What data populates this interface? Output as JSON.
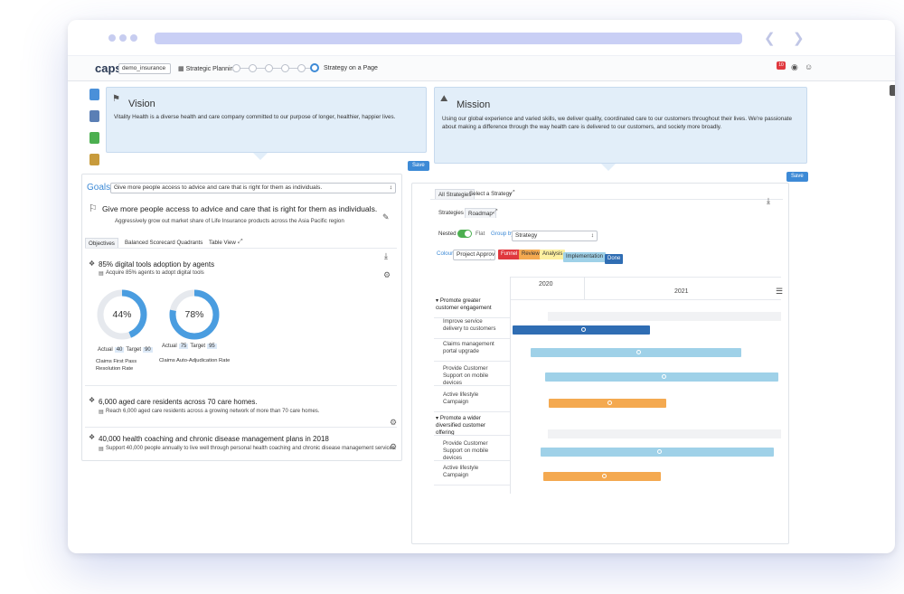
{
  "header": {
    "logo_main": "capsi",
    "logo_accent": "fi",
    "workspace": "demo_insurance",
    "nav_item": "Strategic Planning",
    "current_step": "Strategy on a Page",
    "notifications_count": "10"
  },
  "vision": {
    "title": "Vision",
    "text": "Vitality Health is a diverse health and care company committed to our purpose of longer, healthier, happier lives.",
    "save_label": "Save"
  },
  "mission": {
    "title": "Mission",
    "text": "Using our global experience and varied skills, we deliver quality, coordinated care to our customers throughout their lives. We're passionate about making a difference through the way health care is delivered to our customers, and society more broadly.",
    "save_label": "Save"
  },
  "goals": {
    "label": "Goals",
    "selected": "Give more people access to advice and care that is right for them as individuals.",
    "headline": "Give more people access to advice and care that is right for them as individuals.",
    "subtitle": "Aggressively grow out market share of Life Insurance products across the Asia Pacific region",
    "tabs": [
      "Objectives",
      "Balanced Scorecard Quadrants",
      "Table View"
    ],
    "objectives": [
      {
        "title": "85% digital tools adoption by agents",
        "subtitle": "Acquire 85% agents to adopt digital tools"
      },
      {
        "title": "6,000 aged care residents across 70 care homes.",
        "subtitle": "Reach 6,000 aged care residents across a growing network of more than 70 care homes."
      },
      {
        "title": "40,000 health coaching and chronic disease management plans in 2018",
        "subtitle": "Support 40,000 people annually to live well through personal health coaching and chronic disease management services."
      }
    ],
    "kpis": [
      {
        "pct_label": "44%",
        "pct": 44,
        "actual_label": "Actual",
        "actual": "40",
        "target_label": "Target",
        "target": "90",
        "name": "Claims First Pass Resolution Rate"
      },
      {
        "pct_label": "78%",
        "pct": 78,
        "actual_label": "Actual",
        "actual": "75",
        "target_label": "Target",
        "target": "95",
        "name": "Claims Auto-Adjudication Rate"
      }
    ]
  },
  "strategies": {
    "tabs": [
      "All Strategies",
      "Select a Strategy"
    ],
    "subtabs": [
      "Strategies",
      "Roadmap"
    ],
    "nested_label": "Nested",
    "flat_label": "Flat",
    "group_by_label": "Group by",
    "group_by_value": "Strategy",
    "colour_label": "Colour",
    "colour_value": "Project Approv",
    "stages": [
      {
        "label": "Funnel",
        "color": "#e0383e",
        "text": "#ffffff"
      },
      {
        "label": "Review",
        "color": "#f4a950",
        "text": "#333333"
      },
      {
        "label": "Analysis",
        "color": "#fdf0a0",
        "text": "#333333"
      },
      {
        "label": "Implementation",
        "color": "#9fd1e8",
        "text": "#333333"
      },
      {
        "label": "Done",
        "color": "#2f6db3",
        "text": "#ffffff"
      }
    ],
    "years": [
      "2020",
      "2021"
    ],
    "rows": [
      {
        "label": "Promote greater customer engagement",
        "group": true
      },
      {
        "label": "Improve service delivery to customers",
        "group": false
      },
      {
        "label": "Claims management portal upgrade",
        "group": false
      },
      {
        "label": "Provide Customer Support on mobile devices",
        "group": false
      },
      {
        "label": "Active lifestyle Campaign",
        "group": false
      },
      {
        "label": "Promote a wider diversified customer offering",
        "group": true
      },
      {
        "label": "Provide Customer Support on mobile devices",
        "group": false
      },
      {
        "label": "Active lifestyle Campaign",
        "group": false
      }
    ]
  }
}
